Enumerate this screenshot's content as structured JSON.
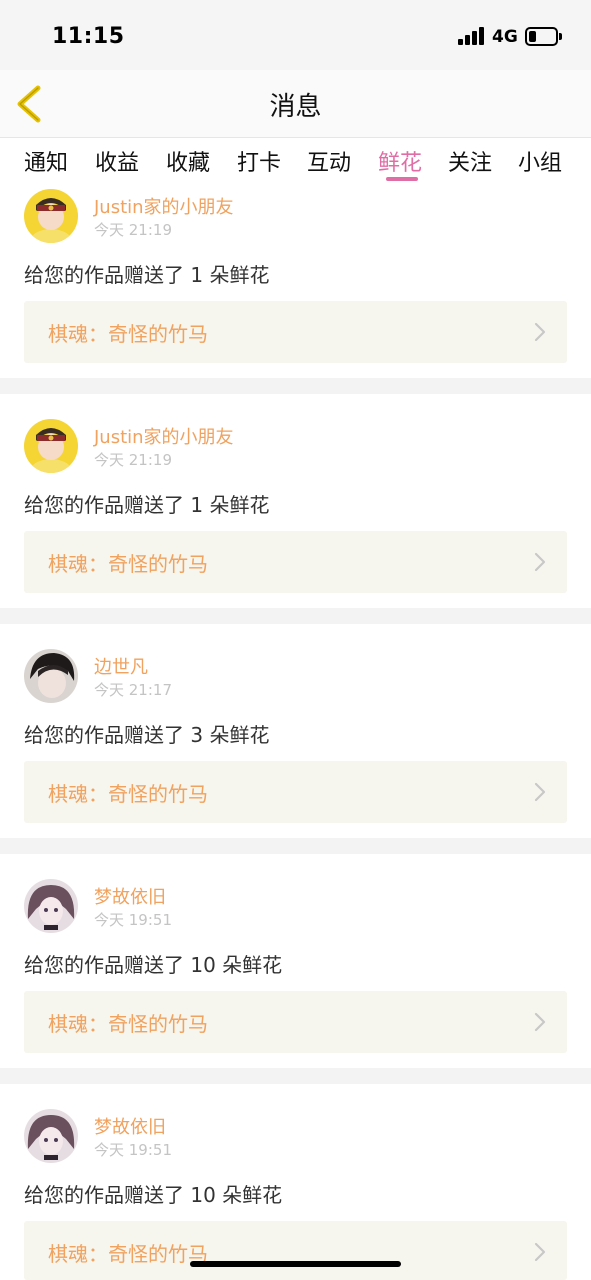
{
  "status_bar": {
    "time": "11:15",
    "network": "4G"
  },
  "nav": {
    "title": "消息"
  },
  "tabs": [
    {
      "label": "通知"
    },
    {
      "label": "收益"
    },
    {
      "label": "收藏"
    },
    {
      "label": "打卡"
    },
    {
      "label": "互动"
    },
    {
      "label": "鲜花",
      "active": true
    },
    {
      "label": "关注"
    },
    {
      "label": "小组"
    }
  ],
  "messages": [
    {
      "user": "Justin家的小朋友",
      "time": "今天 21:19",
      "text": "给您的作品赠送了 1 朵鲜花",
      "work": "棋魂：奇怪的竹马"
    },
    {
      "user": "Justin家的小朋友",
      "time": "今天 21:19",
      "text": "给您的作品赠送了 1 朵鲜花",
      "work": "棋魂：奇怪的竹马"
    },
    {
      "user": "边世凡",
      "time": "今天 21:17",
      "text": "给您的作品赠送了 3 朵鲜花",
      "work": "棋魂：奇怪的竹马"
    },
    {
      "user": "梦故依旧",
      "time": "今天 19:51",
      "text": "给您的作品赠送了 10 朵鲜花",
      "work": "棋魂：奇怪的竹马"
    },
    {
      "user": "梦故依旧",
      "time": "今天 19:51",
      "text": "给您的作品赠送了 10 朵鲜花",
      "work": "棋魂：奇怪的竹马"
    }
  ],
  "colors": {
    "accent": "#e06ea6",
    "username": "#f0a25e",
    "back_icon": "#e6c200"
  },
  "icons": {
    "back": "chevron-left-icon",
    "row_arrow": "chevron-right-icon"
  }
}
